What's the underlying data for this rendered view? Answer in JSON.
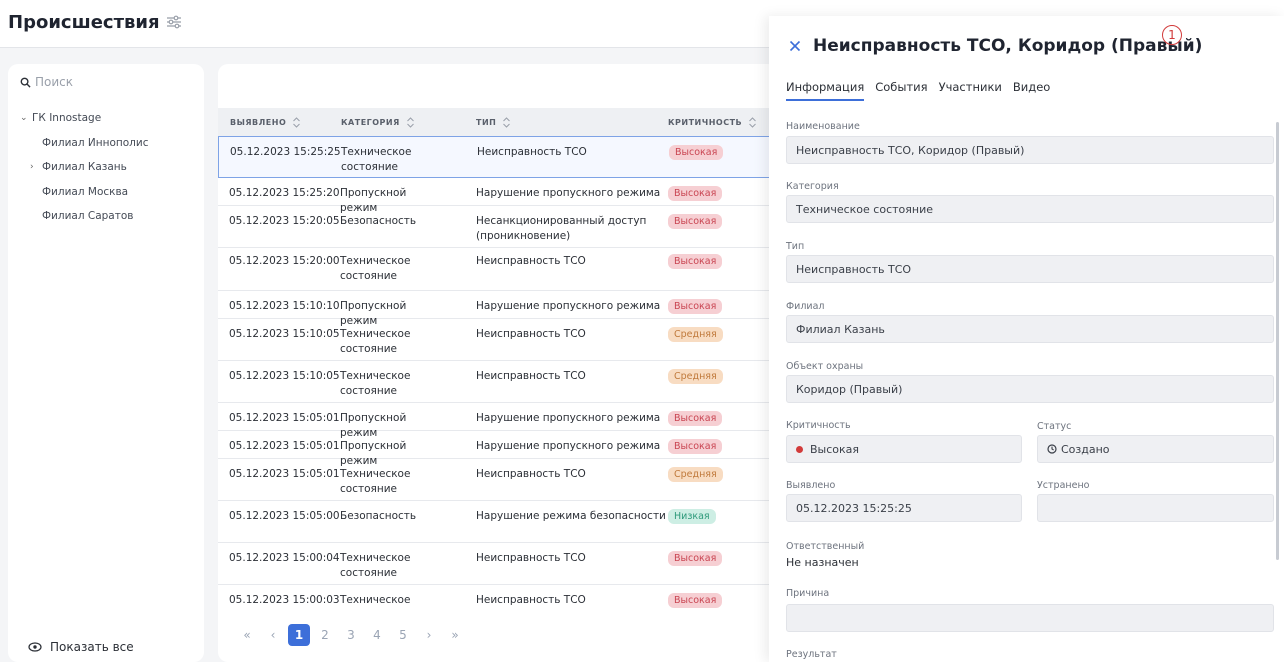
{
  "header": {
    "title": "Происшествия",
    "filter_icon": "sliders-icon"
  },
  "sidebar": {
    "search_placeholder": "Поиск",
    "tree": [
      {
        "label": "ГК Innostage",
        "expanded": true,
        "level": 1
      },
      {
        "label": "Филиал Иннополис",
        "level": 2
      },
      {
        "label": "Филиал Казань",
        "level": 2,
        "collapsible": true
      },
      {
        "label": "Филиал Москва",
        "level": 2
      },
      {
        "label": "Филиал Саратов",
        "level": 2
      }
    ],
    "show_all": "Показать все"
  },
  "table": {
    "columns": [
      "ВЫЯВЛЕНО",
      "КАТЕГОРИЯ",
      "ТИП",
      "КРИТИЧНОСТЬ"
    ],
    "rows": [
      {
        "detected": "05.12.2023 15:25:25",
        "category": "Техническое состояние",
        "type": "Неисправность ТСО",
        "severity": "Высокая",
        "level": "high",
        "selected": true
      },
      {
        "detected": "05.12.2023 15:25:20",
        "category": "Пропускной режим",
        "type": "Нарушение пропускного режима",
        "severity": "Высокая",
        "level": "high"
      },
      {
        "detected": "05.12.2023 15:20:05",
        "category": "Безопасность",
        "type": "Несанкционированный доступ (проникновение)",
        "severity": "Высокая",
        "level": "high"
      },
      {
        "detected": "05.12.2023 15:20:00",
        "category": "Техническое состояние",
        "type": "Неисправность ТСО",
        "severity": "Высокая",
        "level": "high"
      },
      {
        "detected": "05.12.2023 15:10:10",
        "category": "Пропускной режим",
        "type": "Нарушение пропускного режима",
        "severity": "Высокая",
        "level": "high"
      },
      {
        "detected": "05.12.2023 15:10:05",
        "category": "Техническое состояние",
        "type": "Неисправность ТСО",
        "severity": "Средняя",
        "level": "mid"
      },
      {
        "detected": "05.12.2023 15:10:05",
        "category": "Техническое состояние",
        "type": "Неисправность ТСО",
        "severity": "Средняя",
        "level": "mid"
      },
      {
        "detected": "05.12.2023 15:05:01",
        "category": "Пропускной режим",
        "type": "Нарушение пропускного режима",
        "severity": "Высокая",
        "level": "high"
      },
      {
        "detected": "05.12.2023 15:05:01",
        "category": "Пропускной режим",
        "type": "Нарушение пропускного режима",
        "severity": "Высокая",
        "level": "high"
      },
      {
        "detected": "05.12.2023 15:05:01",
        "category": "Техническое состояние",
        "type": "Неисправность ТСО",
        "severity": "Средняя",
        "level": "mid"
      },
      {
        "detected": "05.12.2023 15:05:00",
        "category": "Безопасность",
        "type": "Нарушение режима безопасности",
        "severity": "Низкая",
        "level": "low"
      },
      {
        "detected": "05.12.2023 15:00:04",
        "category": "Техническое состояние",
        "type": "Неисправность ТСО",
        "severity": "Высокая",
        "level": "high"
      },
      {
        "detected": "05.12.2023 15:00:03",
        "category": "Техническое",
        "type": "Неисправность ТСО",
        "severity": "Высокая",
        "level": "high"
      }
    ]
  },
  "pager": {
    "first": "«",
    "prev": "‹",
    "pages": [
      "1",
      "2",
      "3",
      "4",
      "5"
    ],
    "active": "1",
    "next": "›",
    "last": "»"
  },
  "panel": {
    "title": "Неисправность ТСО, Коридор (Правый)",
    "callout": "1",
    "tabs": [
      "Информация",
      "События",
      "Участники",
      "Видео"
    ],
    "active_tab": "Информация",
    "fields": {
      "name_label": "Наименование",
      "name": "Неисправность ТСО, Коридор (Правый)",
      "category_label": "Категория",
      "category": "Техническое состояние",
      "type_label": "Тип",
      "type": "Неисправность ТСО",
      "branch_label": "Филиал",
      "branch": "Филиал Казань",
      "object_label": "Объект охраны",
      "object": "Коридор (Правый)",
      "severity_label": "Критичность",
      "severity": "Высокая",
      "status_label": "Статус",
      "status": "Создано",
      "detected_label": "Выявлено",
      "detected": "05.12.2023 15:25:25",
      "resolved_label": "Устранено",
      "resolved": "",
      "responsible_label": "Ответственный",
      "responsible": "Не назначен",
      "reason_label": "Причина",
      "reason": "",
      "result_label": "Результат"
    }
  },
  "colors": {
    "accent": "#3d6fd9",
    "high": "#c94552",
    "mid": "#c07a3c",
    "low": "#2f9a7b",
    "callout": "#d23b3b"
  }
}
